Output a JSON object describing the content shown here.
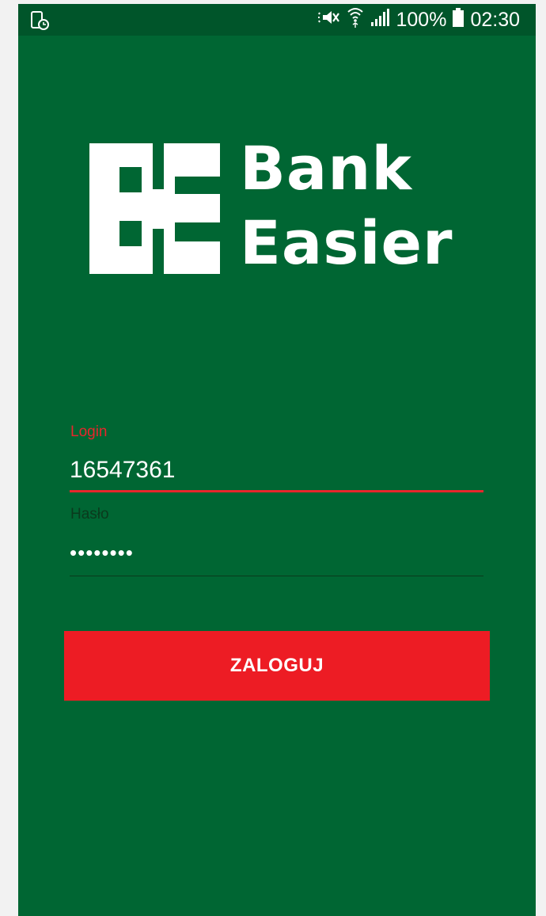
{
  "theme": {
    "screen_bg": "#006633",
    "status_bar_bg": "#00552a",
    "accent": "#ed1c24",
    "text": "#ffffff"
  },
  "status_bar": {
    "icons": [
      "screen-timeout-icon",
      "mute-icon",
      "wifi-icon",
      "signal-icon",
      "battery-icon"
    ],
    "battery": "100%",
    "time": "02:30"
  },
  "logo": {
    "line1": "Bank",
    "line2": "Easier"
  },
  "form": {
    "login": {
      "label": "Login",
      "value": "16547361"
    },
    "password": {
      "label": "Hasło",
      "value": "••••••••"
    },
    "submit_label": "ZALOGUJ"
  }
}
